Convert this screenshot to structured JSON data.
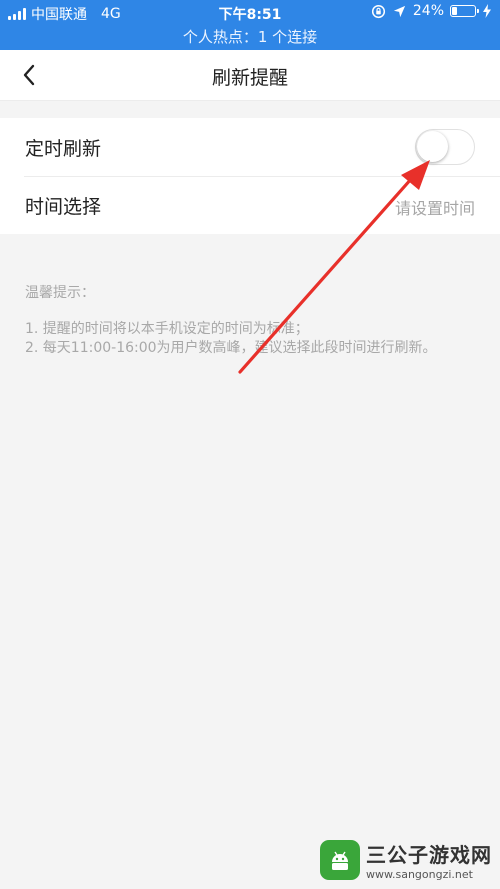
{
  "status_bar": {
    "carrier": "中国联通",
    "network": "4G",
    "time": "下午8:51",
    "battery_percent_label": "24%",
    "battery_level": 0.24,
    "hotspot": "个人热点：1 个连接",
    "color": "#2f86e6"
  },
  "nav": {
    "title": "刷新提醒",
    "back_icon": "chevron-left-icon"
  },
  "settings": {
    "timed_refresh": {
      "label": "定时刷新",
      "enabled": false
    },
    "time_select": {
      "label": "时间选择",
      "value": "请设置时间"
    }
  },
  "tips": {
    "title": "温馨提示：",
    "items": [
      "1. 提醒的时间将以本手机设定的时间为标准；",
      "2. 每天11:00-16:00为用户数高峰，建议选择此段时间进行刷新。"
    ]
  },
  "annotation": {
    "color": "#e8302a"
  },
  "watermark": {
    "name": "三公子游戏网",
    "url": "www.sangongzi.net"
  }
}
